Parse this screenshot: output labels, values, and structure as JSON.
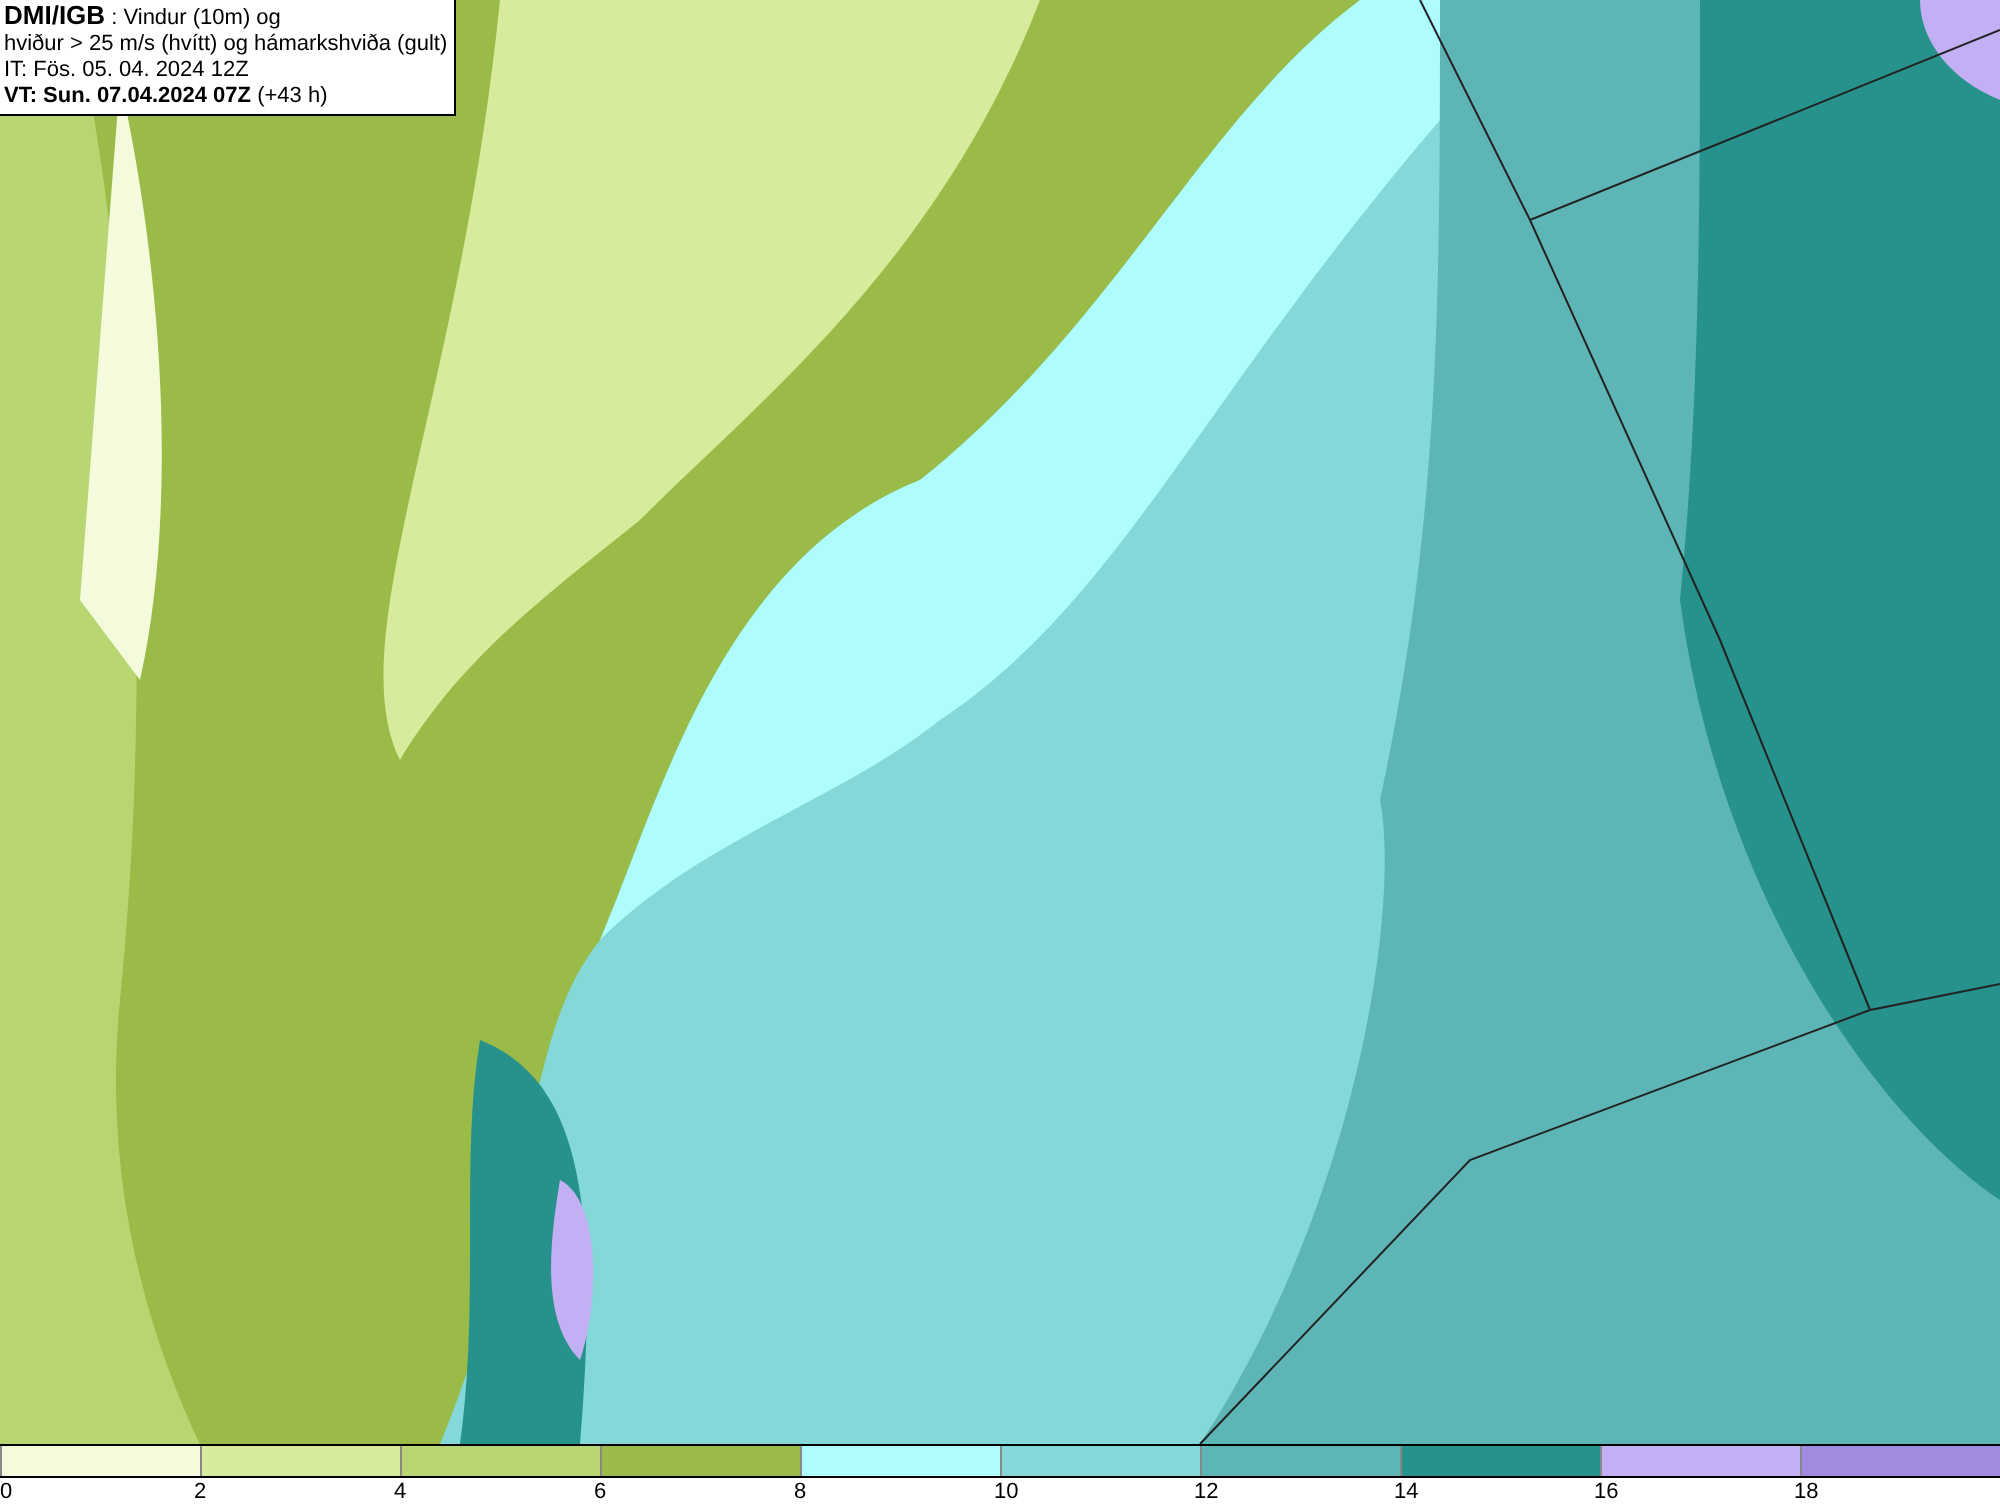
{
  "title_box": {
    "lines": [
      "**DMI/IGB** : Vindur (10m) og",
      "hviður > 25 m/s (hvítt) og hámarkshviða (gult)",
      "IT: Fös. 05. 04. 2024 12Z",
      "**VT: Sun. 07.04.2024 07Z** (+43 h)"
    ]
  },
  "legend": [
    {
      "label": "0",
      "color": "#f4fbdc"
    },
    {
      "label": "2",
      "color": "#d6ec9c"
    },
    {
      "label": "4",
      "color": "#b7d672"
    },
    {
      "label": "6",
      "color": "#9abb48"
    },
    {
      "label": "8",
      "color": "#aefcfc"
    },
    {
      "label": "10",
      "color": "#84d8d8"
    },
    {
      "label": "12",
      "color": "#5db5b5"
    },
    {
      "label": "14",
      "color": "#27928c"
    },
    {
      "label": "16",
      "color": "#c3b0f4"
    },
    {
      "label": "18",
      "color": "#a18be0"
    }
  ]
}
